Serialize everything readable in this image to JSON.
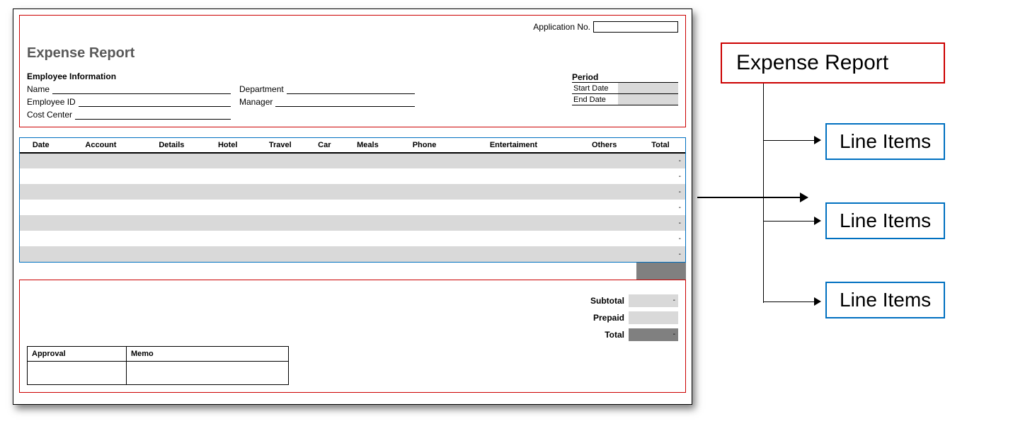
{
  "document": {
    "application_no_label": "Application No.",
    "title": "Expense Report",
    "employee_info_title": "Employee Information",
    "fields": {
      "name": "Name",
      "employee_id": "Employee ID",
      "cost_center": "Cost Center",
      "department": "Department",
      "manager": "Manager"
    },
    "period": {
      "title": "Period",
      "start": "Start Date",
      "end": "End Date"
    },
    "columns": [
      "Date",
      "Account",
      "Details",
      "Hotel",
      "Travel",
      "Car",
      "Meals",
      "Phone",
      "Entertaiment",
      "Others",
      "Total"
    ],
    "row_placeholder": "-",
    "summary": {
      "subtotal": "Subtotal",
      "prepaid": "Prepaid",
      "total": "Total",
      "dash": "-"
    },
    "approval": {
      "approval": "Approval",
      "memo": "Memo"
    }
  },
  "hierarchy": {
    "parent": "Expense Report",
    "children": [
      "Line Items",
      "Line Items",
      "Line Items"
    ]
  }
}
